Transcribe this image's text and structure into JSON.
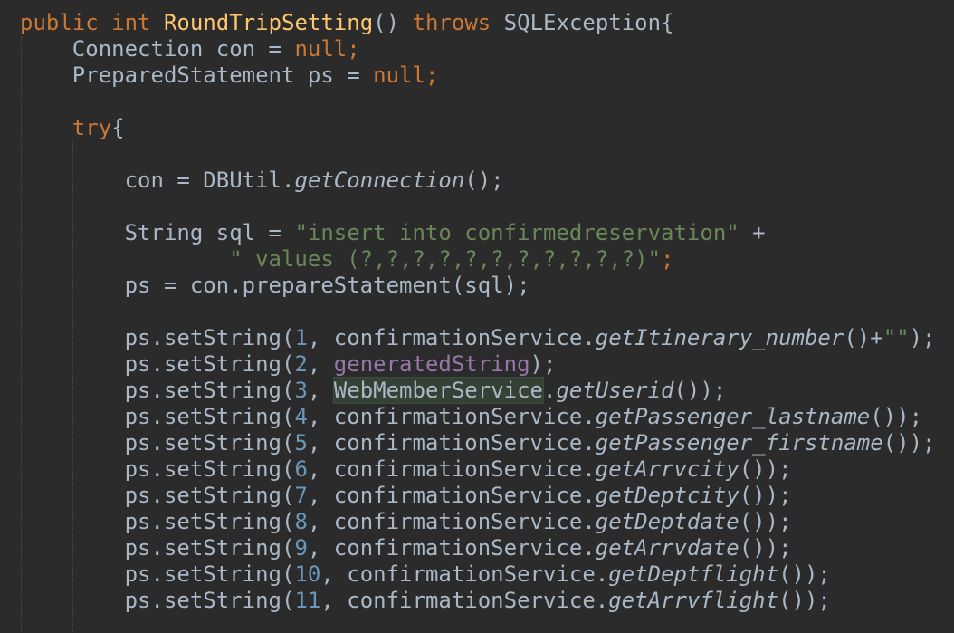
{
  "editor": {
    "lines": [
      {
        "indent": "",
        "tokens": [
          {
            "text": "public",
            "cls": "kw"
          },
          {
            "text": " ",
            "cls": ""
          },
          {
            "text": "int",
            "cls": "kw"
          },
          {
            "text": " ",
            "cls": ""
          },
          {
            "text": "RoundTripSetting",
            "cls": "fn"
          },
          {
            "text": "() ",
            "cls": ""
          },
          {
            "text": "throws",
            "cls": "kw"
          },
          {
            "text": " SQLException{",
            "cls": ""
          }
        ]
      },
      {
        "indent": "    ",
        "tokens": [
          {
            "text": "Connection con = ",
            "cls": ""
          },
          {
            "text": "null",
            "cls": "kw"
          },
          {
            "text": ";",
            "cls": "kw"
          }
        ]
      },
      {
        "indent": "    ",
        "tokens": [
          {
            "text": "PreparedStatement ps = ",
            "cls": ""
          },
          {
            "text": "null",
            "cls": "kw"
          },
          {
            "text": ";",
            "cls": "kw"
          }
        ]
      },
      {
        "indent": "",
        "tokens": []
      },
      {
        "indent": "    ",
        "tokens": [
          {
            "text": "try",
            "cls": "kw"
          },
          {
            "text": "{",
            "cls": ""
          }
        ]
      },
      {
        "indent": "",
        "tokens": []
      },
      {
        "indent": "        ",
        "tokens": [
          {
            "text": "con = DBUtil.",
            "cls": ""
          },
          {
            "text": "getConnection",
            "cls": "it"
          },
          {
            "text": "();",
            "cls": ""
          }
        ]
      },
      {
        "indent": "",
        "tokens": []
      },
      {
        "indent": "        ",
        "tokens": [
          {
            "text": "String sql = ",
            "cls": ""
          },
          {
            "text": "\"insert into confirmedreservation\"",
            "cls": "str"
          },
          {
            "text": " +",
            "cls": ""
          }
        ]
      },
      {
        "indent": "                ",
        "tokens": [
          {
            "text": "\" values (?,?,?,?,?,?,?,?,?,?,?)\"",
            "cls": "str"
          },
          {
            "text": ";",
            "cls": "kw"
          }
        ]
      },
      {
        "indent": "        ",
        "tokens": [
          {
            "text": "ps = con.prepareStatement(sql);",
            "cls": ""
          }
        ]
      },
      {
        "indent": "",
        "tokens": []
      },
      {
        "indent": "        ",
        "tokens": [
          {
            "text": "ps.setString(",
            "cls": ""
          },
          {
            "text": "1",
            "cls": "num"
          },
          {
            "text": ", confirmationService.",
            "cls": ""
          },
          {
            "text": "getItinerary_number",
            "cls": "it"
          },
          {
            "text": "()+",
            "cls": ""
          },
          {
            "text": "\"\"",
            "cls": "str"
          },
          {
            "text": ");",
            "cls": ""
          }
        ]
      },
      {
        "indent": "        ",
        "tokens": [
          {
            "text": "ps.setString(",
            "cls": ""
          },
          {
            "text": "2",
            "cls": "num"
          },
          {
            "text": ", ",
            "cls": ""
          },
          {
            "text": "generatedString",
            "cls": "field"
          },
          {
            "text": ");",
            "cls": ""
          }
        ]
      },
      {
        "indent": "        ",
        "tokens": [
          {
            "text": "ps.setString(",
            "cls": ""
          },
          {
            "text": "3",
            "cls": "num"
          },
          {
            "text": ", ",
            "cls": ""
          },
          {
            "text": "WebMemberService",
            "cls": "hl"
          },
          {
            "text": ".",
            "cls": ""
          },
          {
            "text": "getUserid",
            "cls": "it"
          },
          {
            "text": "());",
            "cls": ""
          }
        ]
      },
      {
        "indent": "        ",
        "tokens": [
          {
            "text": "ps.setString(",
            "cls": ""
          },
          {
            "text": "4",
            "cls": "num"
          },
          {
            "text": ", confirmationService.",
            "cls": ""
          },
          {
            "text": "getPassenger_lastname",
            "cls": "it"
          },
          {
            "text": "());",
            "cls": ""
          }
        ]
      },
      {
        "indent": "        ",
        "tokens": [
          {
            "text": "ps.setString(",
            "cls": ""
          },
          {
            "text": "5",
            "cls": "num"
          },
          {
            "text": ", confirmationService.",
            "cls": ""
          },
          {
            "text": "getPassenger_firstname",
            "cls": "it"
          },
          {
            "text": "());",
            "cls": ""
          }
        ]
      },
      {
        "indent": "        ",
        "tokens": [
          {
            "text": "ps.setString(",
            "cls": ""
          },
          {
            "text": "6",
            "cls": "num"
          },
          {
            "text": ", confirmationService.",
            "cls": ""
          },
          {
            "text": "getArrvcity",
            "cls": "it"
          },
          {
            "text": "());",
            "cls": ""
          }
        ]
      },
      {
        "indent": "        ",
        "tokens": [
          {
            "text": "ps.setString(",
            "cls": ""
          },
          {
            "text": "7",
            "cls": "num"
          },
          {
            "text": ", confirmationService.",
            "cls": ""
          },
          {
            "text": "getDeptcity",
            "cls": "it"
          },
          {
            "text": "());",
            "cls": ""
          }
        ]
      },
      {
        "indent": "        ",
        "tokens": [
          {
            "text": "ps.setString(",
            "cls": ""
          },
          {
            "text": "8",
            "cls": "num"
          },
          {
            "text": ", confirmationService.",
            "cls": ""
          },
          {
            "text": "getDeptdate",
            "cls": "it"
          },
          {
            "text": "());",
            "cls": ""
          }
        ]
      },
      {
        "indent": "        ",
        "tokens": [
          {
            "text": "ps.setString(",
            "cls": ""
          },
          {
            "text": "9",
            "cls": "num"
          },
          {
            "text": ", confirmationService.",
            "cls": ""
          },
          {
            "text": "getArrvdate",
            "cls": "it"
          },
          {
            "text": "());",
            "cls": ""
          }
        ]
      },
      {
        "indent": "        ",
        "tokens": [
          {
            "text": "ps.setString(",
            "cls": ""
          },
          {
            "text": "10",
            "cls": "num"
          },
          {
            "text": ", confirmationService.",
            "cls": ""
          },
          {
            "text": "getDeptflight",
            "cls": "it"
          },
          {
            "text": "());",
            "cls": ""
          }
        ]
      },
      {
        "indent": "        ",
        "tokens": [
          {
            "text": "ps.setString(",
            "cls": ""
          },
          {
            "text": "11",
            "cls": "num"
          },
          {
            "text": ", confirmationService.",
            "cls": ""
          },
          {
            "text": "getArrvflight",
            "cls": "it"
          },
          {
            "text": "());",
            "cls": ""
          }
        ]
      }
    ]
  },
  "colors": {
    "background": "#2b2b2b",
    "default_text": "#a9b7c6",
    "keyword": "#cc7832",
    "method_declaration": "#ffc66d",
    "string": "#6a8759",
    "number": "#6897bb",
    "field": "#9876aa",
    "highlight_background": "#344134"
  }
}
